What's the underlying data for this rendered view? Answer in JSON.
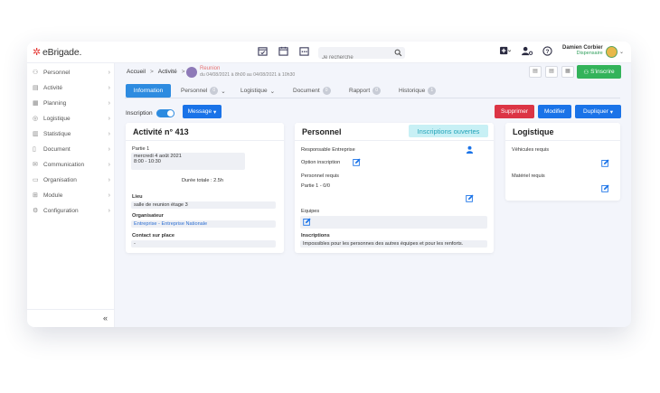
{
  "app": {
    "logo": "eBrigade."
  },
  "search": {
    "placeholder": "Je recherche"
  },
  "user": {
    "name": "Damien Corbier",
    "role": "Dispensaire"
  },
  "sidebar": {
    "items": [
      {
        "label": "Personnel",
        "icon": "person-icon"
      },
      {
        "label": "Activité",
        "icon": "calendar-icon"
      },
      {
        "label": "Planning",
        "icon": "planning-icon"
      },
      {
        "label": "Logistique",
        "icon": "logistics-icon"
      },
      {
        "label": "Statistique",
        "icon": "stats-icon"
      },
      {
        "label": "Document",
        "icon": "document-icon"
      },
      {
        "label": "Communication",
        "icon": "mail-icon"
      },
      {
        "label": "Organisation",
        "icon": "organisation-icon"
      },
      {
        "label": "Module",
        "icon": "module-icon"
      },
      {
        "label": "Configuration",
        "icon": "gear-icon"
      }
    ],
    "collapse": "«"
  },
  "breadcrumb": {
    "home": "Accueil",
    "section": "Activité",
    "sep": ">"
  },
  "activity": {
    "title": "Reunion",
    "dates": "du 04/08/2021 à 8h00 au 04/08/2021 à 10h30"
  },
  "header": {
    "inscrire_label": "S'inscrire"
  },
  "tabs": [
    {
      "label": "Information",
      "count": ""
    },
    {
      "label": "Personnel",
      "count": "0"
    },
    {
      "label": "Logistique",
      "count": ""
    },
    {
      "label": "Document",
      "count": "0"
    },
    {
      "label": "Rapport",
      "count": "0"
    },
    {
      "label": "Historique",
      "count": "1"
    }
  ],
  "toolbar": {
    "inscription_label": "Inscription",
    "message_label": "Message",
    "delete_label": "Supprimer",
    "modify_label": "Modifier",
    "duplicate_label": "Dupliquer"
  },
  "card_activity": {
    "title": "Activité n° 413",
    "part_label": "Partie 1",
    "part_date": "mercredi 4 août 2021",
    "part_time": "8:00 - 10:30",
    "duration": "Durée totale : 2.5h",
    "lieu_label": "Lieu",
    "lieu_value": "salle de reunion étage 3",
    "org_label": "Organisateur",
    "org_value": "Entreprise - Entreprise Nationale",
    "contact_label": "Contact sur place",
    "contact_value": "-"
  },
  "card_personnel": {
    "title": "Personnel",
    "badge": "Inscriptions ouvertes",
    "resp_label": "Responsable Entreprise",
    "option_label": "Option inscription",
    "requis_label": "Personnel requis",
    "requis_value": "Partie 1 - 0/0",
    "equipes_label": "Equipes",
    "inscriptions_label": "Inscriptions",
    "inscriptions_value": "Impossibles pour les personnes des autres équipes et pour les renforts."
  },
  "card_logistique": {
    "title": "Logistique",
    "vehicules_label": "Véhicules requis",
    "materiel_label": "Matériel requis"
  }
}
